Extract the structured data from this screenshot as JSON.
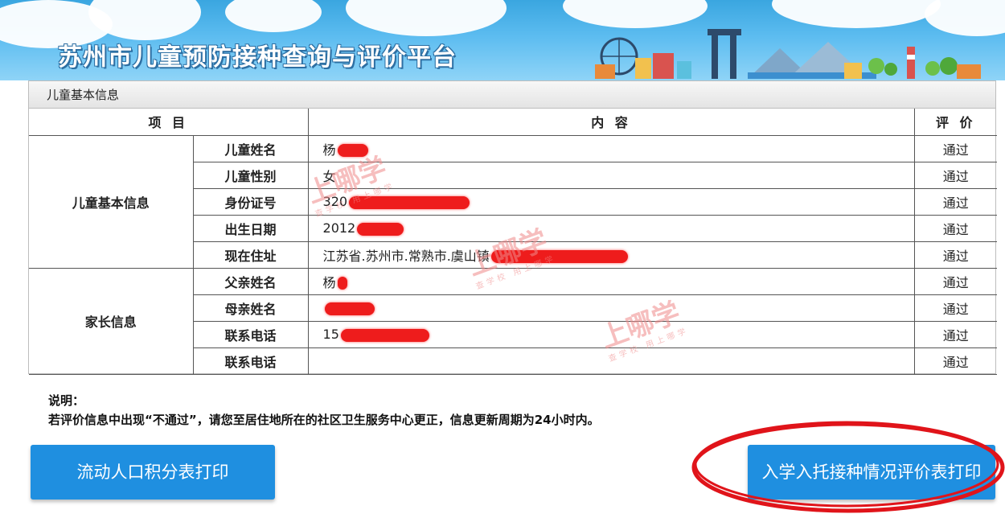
{
  "header": {
    "title": "苏州市儿童预防接种查询与评价平台"
  },
  "panel": {
    "title": "儿童基本信息",
    "columns": {
      "item": "项 目",
      "content": "内 容",
      "evaluation": "评 价"
    },
    "groups": [
      {
        "label": "儿童基本信息",
        "rows": [
          {
            "field": "儿童姓名",
            "value": "杨",
            "eval": "通过"
          },
          {
            "field": "儿童性别",
            "value": "女",
            "eval": "通过"
          },
          {
            "field": "身份证号",
            "value": "320",
            "eval": "通过"
          },
          {
            "field": "出生日期",
            "value": "2012",
            "eval": "通过"
          },
          {
            "field": "现在住址",
            "value": "江苏省.苏州市.常熟市.虞山镇",
            "eval": "通过"
          }
        ]
      },
      {
        "label": "家长信息",
        "rows": [
          {
            "field": "父亲姓名",
            "value": "杨",
            "eval": "通过"
          },
          {
            "field": "母亲姓名",
            "value": "",
            "eval": "通过"
          },
          {
            "field": "联系电话",
            "value": "15",
            "eval": "通过"
          },
          {
            "field": "联系电话",
            "value": "",
            "eval": "通过"
          }
        ]
      }
    ]
  },
  "watermark": {
    "main": "上哪学",
    "sub": "查学校 用上哪学"
  },
  "note": {
    "title": "说明：",
    "text": "若评价信息中出现“不通过”，请您至居住地所在的社区卫生服务中心更正，信息更新周期为24小时内。"
  },
  "buttons": {
    "left_label": "流动人口积分表打印",
    "right_label": "入学入托接种情况评价表打印"
  },
  "colors": {
    "banner": "#3aa6e0",
    "button": "#1f8fe0",
    "redaction": "#ee1c1c"
  }
}
